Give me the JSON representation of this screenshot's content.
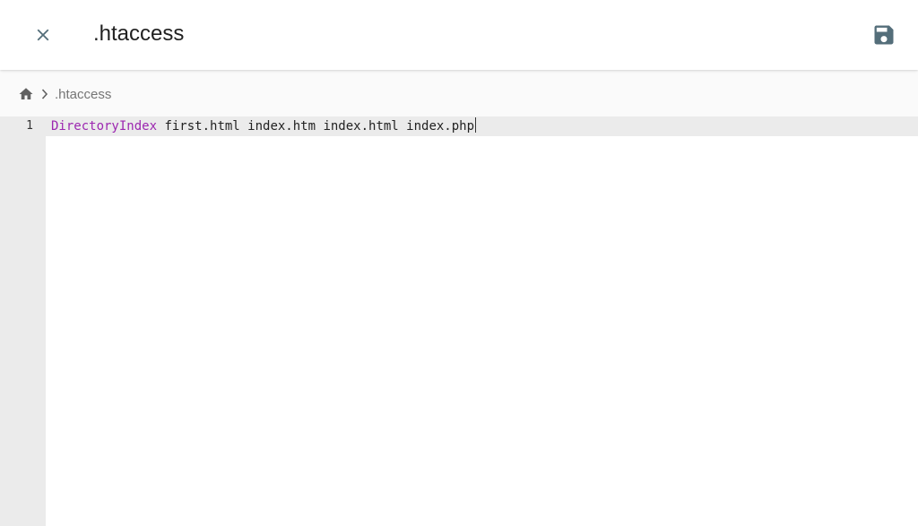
{
  "header": {
    "title": ".htaccess",
    "close_icon": "close-icon",
    "save_icon": "save-icon"
  },
  "breadcrumb": {
    "home_icon": "home-icon",
    "separator_icon": "chevron-right-icon",
    "file": ".htaccess"
  },
  "editor": {
    "lines": [
      {
        "number": "1",
        "keyword": "DirectoryIndex",
        "rest": " first.html index.htm index.html index.php"
      }
    ]
  },
  "colors": {
    "keyword": "#9c27b0",
    "icon": "#546e7a",
    "gutter": "#ebebeb",
    "active_line": "#ebebeb"
  }
}
